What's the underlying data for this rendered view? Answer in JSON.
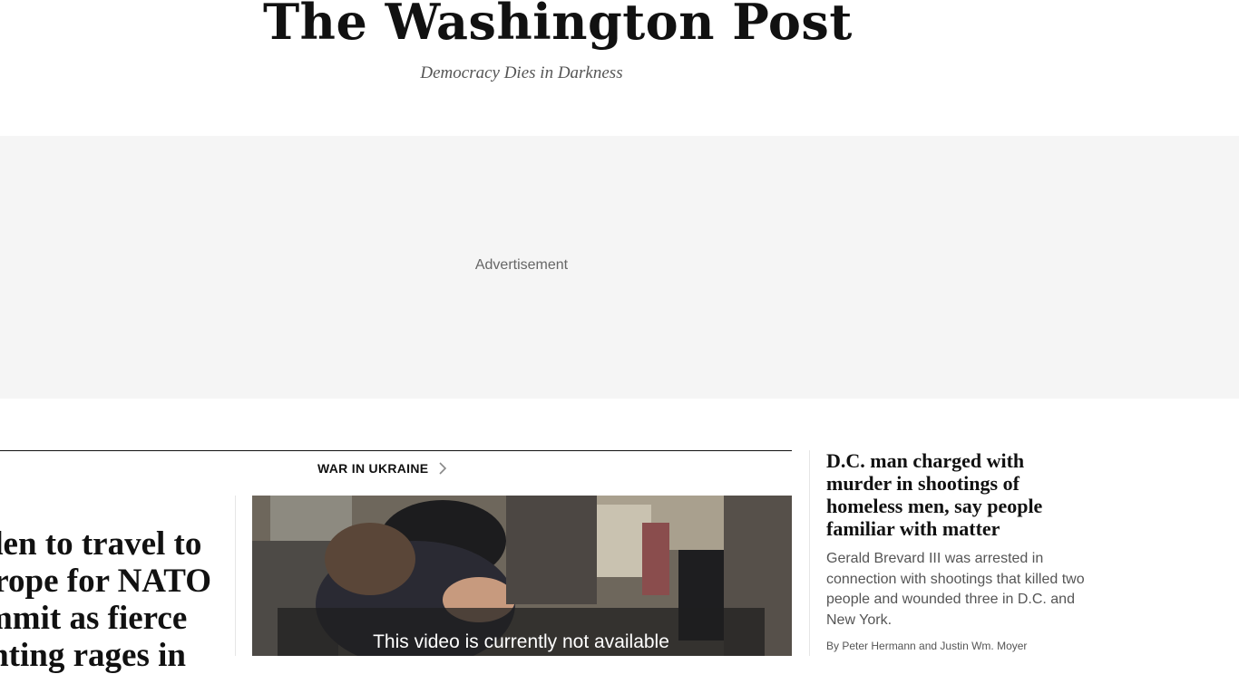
{
  "masthead": {
    "logo_text": "The Washington Post",
    "tagline": "Democracy Dies in Darkness"
  },
  "ad": {
    "label": "Advertisement"
  },
  "lead": {
    "kicker": "WAR IN UKRAINE",
    "kicker_icon": "chevron-right-icon",
    "headline": "Biden to travel to Europe for NATO summit as fierce fighting rages in",
    "video": {
      "message": "This video is currently not available"
    }
  },
  "side_story": {
    "headline": "D.C. man charged with murder in shootings of homeless men, say people familiar with matter",
    "blurb": "Gerald Brevard III was arrested in connection with shootings that killed two people and wounded three in D.C. and New York.",
    "byline": "By Peter Hermann and Justin Wm. Moyer"
  },
  "colors": {
    "text": "#111111",
    "muted": "#555555",
    "ad_background": "#f5f5f5",
    "divider": "#e6e6e6"
  }
}
